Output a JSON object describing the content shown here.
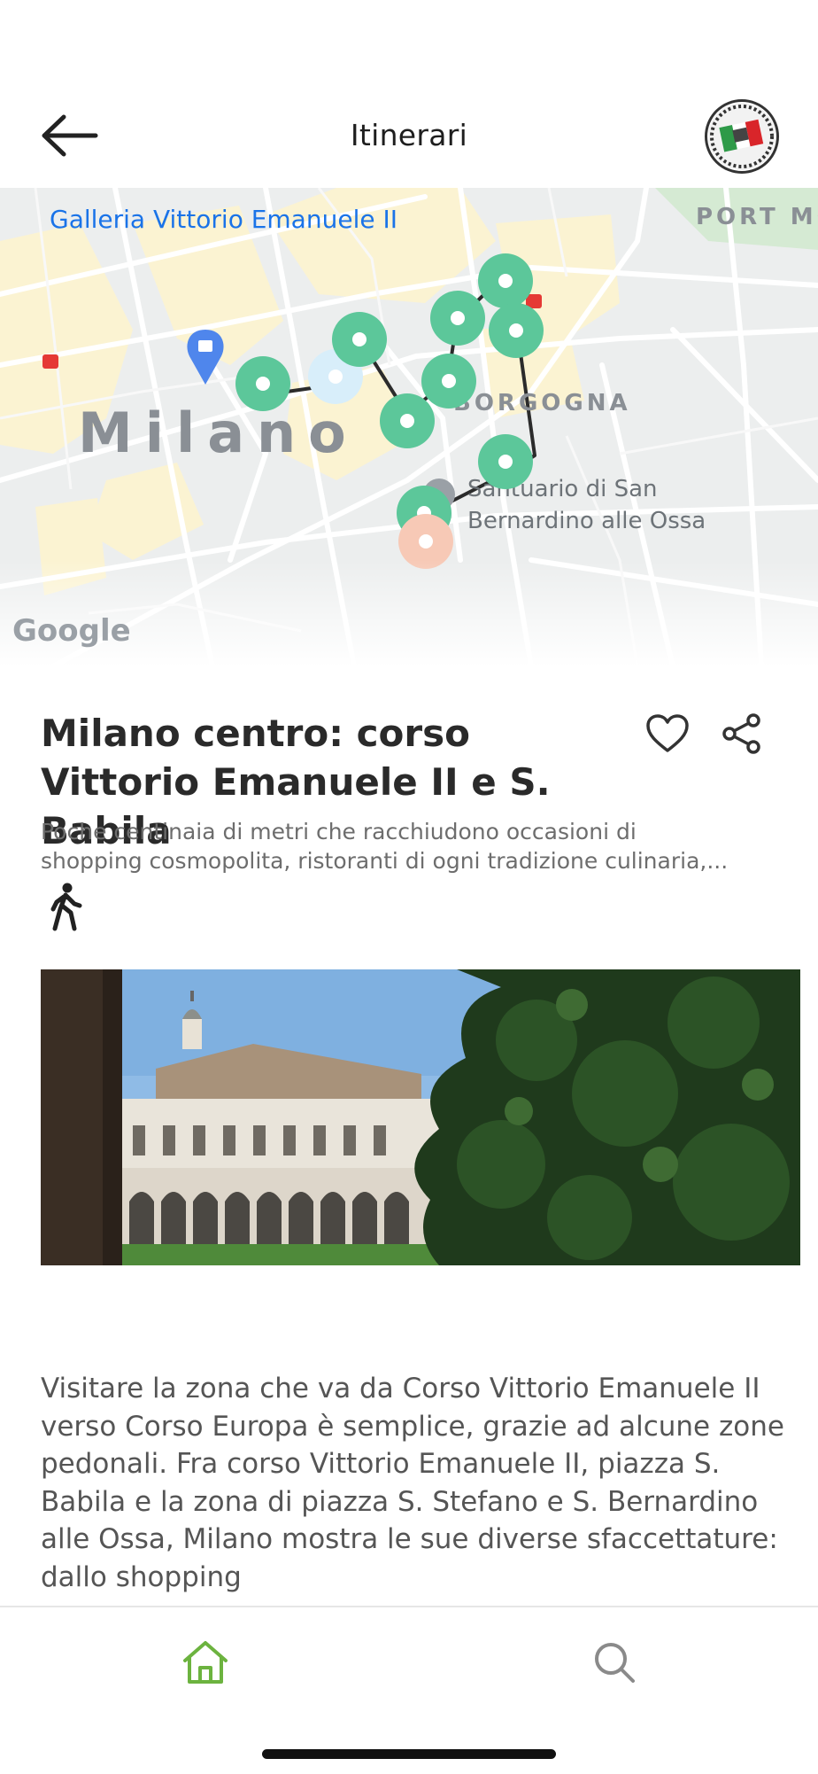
{
  "header": {
    "title": "Itinerari",
    "back_icon": "arrow-left-icon",
    "profile_icon": "italian-flag-badge-icon"
  },
  "map": {
    "labels": {
      "galleria": "Galleria Vittorio Emanuele II",
      "city": "Milano",
      "district": "BORGOGNA",
      "porta": "PORT MONFO",
      "santuario": "Santuario di San Bernardino alle Ossa",
      "attribution": "Google"
    },
    "route_color": "#2b2b2b",
    "pin_colors": {
      "stop": "#5cc79a",
      "current": "#d8eefa",
      "end": "#f7c9b6"
    }
  },
  "itinerary": {
    "title": "Milano centro: corso Vittorio Emanuele II e S. Babila",
    "description": "Poche centinaia di metri che racchiudono occasioni di shopping cosmopolita, ristoranti di ogni tradizione culinaria,...",
    "description_line1": "Poche centinaia di metri che racchiudono occasioni di",
    "description_line2": "shopping cosmopolita, ristoranti di ogni tradizione culinaria,...",
    "mode_icon": "walking-icon",
    "favorite_icon": "heart-icon",
    "share_icon": "share-icon",
    "body": "Visitare la zona che va da Corso Vittorio Emanuele II verso Corso Europa è semplice, grazie ad alcune zone pedonali. Fra corso Vittorio Emanuele II, piazza S. Babila e la zona di piazza S. Stefano e S. Bernardino alle Ossa, Milano mostra le sue diverse sfaccettature: dallo shopping"
  },
  "bottom_nav": {
    "items": [
      {
        "icon": "home-icon",
        "active": true,
        "color": "#6cb33f"
      },
      {
        "icon": "search-icon",
        "active": false,
        "color": "#8a8a8a"
      }
    ]
  }
}
